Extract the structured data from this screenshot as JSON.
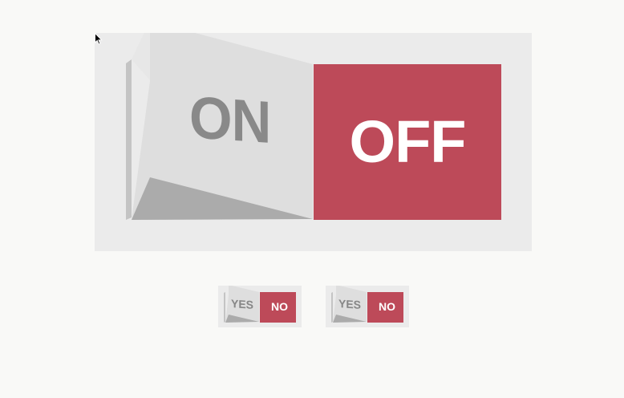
{
  "big_switch": {
    "on_label": "ON",
    "off_label": "OFF",
    "state": "on"
  },
  "small_switches": [
    {
      "on_label": "YES",
      "off_label": "NO",
      "state": "on"
    },
    {
      "on_label": "YES",
      "off_label": "NO",
      "state": "on"
    }
  ],
  "colors": {
    "off_face": "#bd4a59",
    "on_face": "#dedede",
    "shadow": "#ababab",
    "track": "#ebebeb",
    "on_text": "#898989",
    "background": "#f9f9f7"
  },
  "icons": {
    "pointer": "mouse-pointer-icon"
  }
}
